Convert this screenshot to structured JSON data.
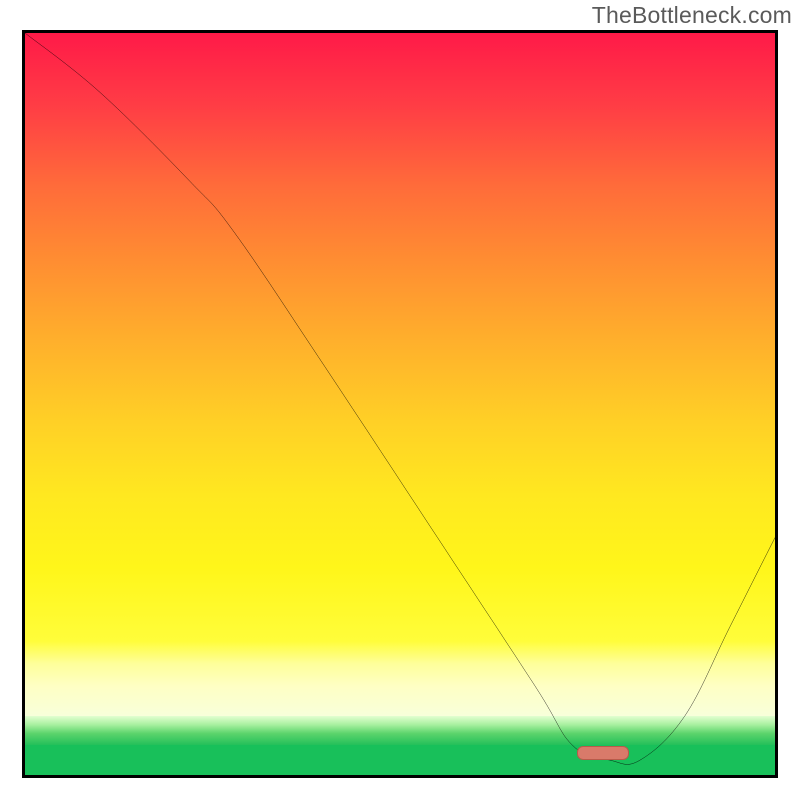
{
  "watermark": "TheBottleneck.com",
  "chart_data": {
    "type": "line",
    "title": "",
    "xlabel": "",
    "ylabel": "",
    "xlim": [
      0,
      100
    ],
    "ylim": [
      0,
      100
    ],
    "series": [
      {
        "name": "bottleneck-curve",
        "x": [
          0,
          10,
          22,
          28,
          40,
          55,
          68,
          73,
          78,
          82,
          88,
          94,
          100
        ],
        "y": [
          100,
          92,
          80,
          73,
          55,
          32,
          12,
          4,
          2,
          2,
          8,
          20,
          32
        ]
      }
    ],
    "optimal_marker": {
      "x": 77,
      "y": 3
    },
    "background_bands": [
      {
        "name": "red-yellow-gradient",
        "from_y": 18,
        "to_y": 100
      },
      {
        "name": "pale-yellow",
        "from_y": 8,
        "to_y": 18
      },
      {
        "name": "green-transition",
        "from_y": 4,
        "to_y": 8
      },
      {
        "name": "green",
        "from_y": 0,
        "to_y": 4
      }
    ]
  }
}
